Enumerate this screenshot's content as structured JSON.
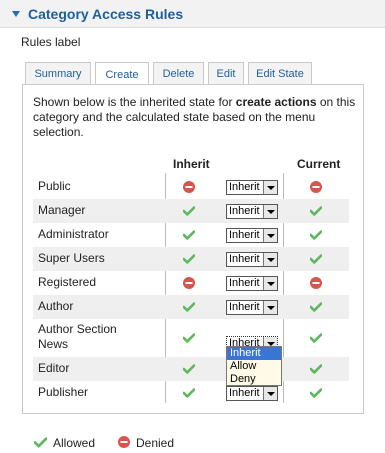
{
  "panel": {
    "title": "Category Access Rules"
  },
  "rules_label": "Rules label",
  "tabs": [
    {
      "label": "Summary",
      "active": false
    },
    {
      "label": "Create",
      "active": true
    },
    {
      "label": "Delete",
      "active": false
    },
    {
      "label": "Edit",
      "active": false
    },
    {
      "label": "Edit State",
      "active": false
    }
  ],
  "description": {
    "pre": "Shown below is the inherited state for ",
    "bold": "create actions",
    "post": " on this category and the calculated state based on the menu selection."
  },
  "columns": {
    "inherit": "Inherit",
    "current": "Current"
  },
  "groups": [
    {
      "name": "Public",
      "inherit": "denied",
      "select": "Inherit",
      "current": "denied"
    },
    {
      "name": "Manager",
      "inherit": "allowed",
      "select": "Inherit",
      "current": "allowed"
    },
    {
      "name": "Administrator",
      "inherit": "allowed",
      "select": "Inherit",
      "current": "allowed"
    },
    {
      "name": "Super Users",
      "inherit": "allowed",
      "select": "Inherit",
      "current": "allowed"
    },
    {
      "name": "Registered",
      "inherit": "denied",
      "select": "Inherit",
      "current": "denied"
    },
    {
      "name": "Author",
      "inherit": "allowed",
      "select": "Inherit",
      "current": "allowed"
    },
    {
      "name": "Author Section News",
      "inherit": "allowed",
      "select": "Inherit",
      "current": "allowed"
    },
    {
      "name": "Editor",
      "inherit": "allowed",
      "select": "Inherit",
      "current": "allowed"
    },
    {
      "name": "Publisher",
      "inherit": "allowed",
      "select": "Inherit",
      "current": "allowed"
    }
  ],
  "dropdown": {
    "options": [
      "Inherit",
      "Allow",
      "Deny"
    ],
    "selected": "Inherit"
  },
  "legend": {
    "allowed": "Allowed",
    "denied": "Denied"
  },
  "colors": {
    "allowed": "#5cb85c",
    "denied": "#d9534f",
    "link": "#1f5f9e"
  }
}
